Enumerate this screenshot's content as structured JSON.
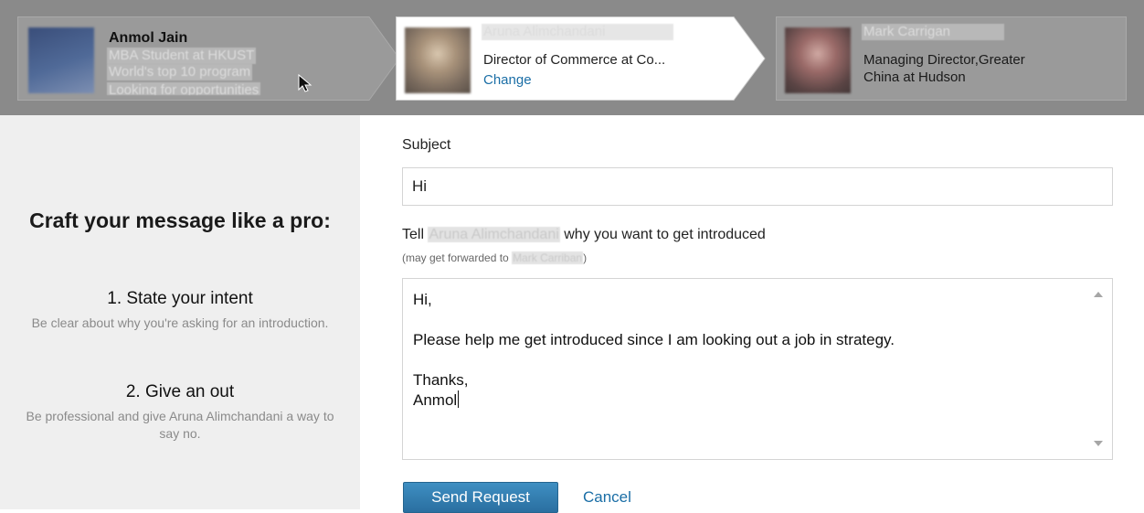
{
  "chain": {
    "from": {
      "name": "Anmol Jain",
      "headline_lines": [
        "MBA Student at HKUST",
        "World's top 10 program",
        "Looking for opportunities"
      ]
    },
    "via": {
      "name": "Aruna Alimchandani",
      "title": "Director of Commerce at Co...",
      "change_label": "Change"
    },
    "to": {
      "name": "Mark Carrigan",
      "title_lines": [
        "Managing Director,Greater",
        "China at Hudson"
      ]
    }
  },
  "tips": {
    "heading": "Craft your message like a pro:",
    "items": [
      {
        "title": "1. State your intent",
        "body": "Be clear about why you're asking for an introduction."
      },
      {
        "title": "2. Give an out",
        "body": "Be professional and give Aruna Alimchandani a way to say no."
      }
    ]
  },
  "form": {
    "subject_label": "Subject",
    "subject_value": "Hi",
    "tell_prefix": "Tell",
    "tell_name": "Aruna Alimchandani",
    "tell_suffix": "why you want to get introduced",
    "forward_prefix": "(may get forwarded to",
    "forward_name": "Mark Carriban",
    "forward_suffix": ")",
    "message_lines": [
      "Hi,",
      "",
      "Please help me get introduced since I am looking out a job in strategy.",
      "",
      "Thanks,",
      "Anmol"
    ],
    "send_label": "Send Request",
    "cancel_label": "Cancel"
  },
  "icons": {
    "cursor": "mouse-pointer-icon",
    "scroll_up": "scroll-up-icon",
    "scroll_down": "scroll-down-icon"
  },
  "colors": {
    "link": "#1a6ea6",
    "primary_button": "#2f7db2",
    "chain_background": "#8a8a8a"
  }
}
